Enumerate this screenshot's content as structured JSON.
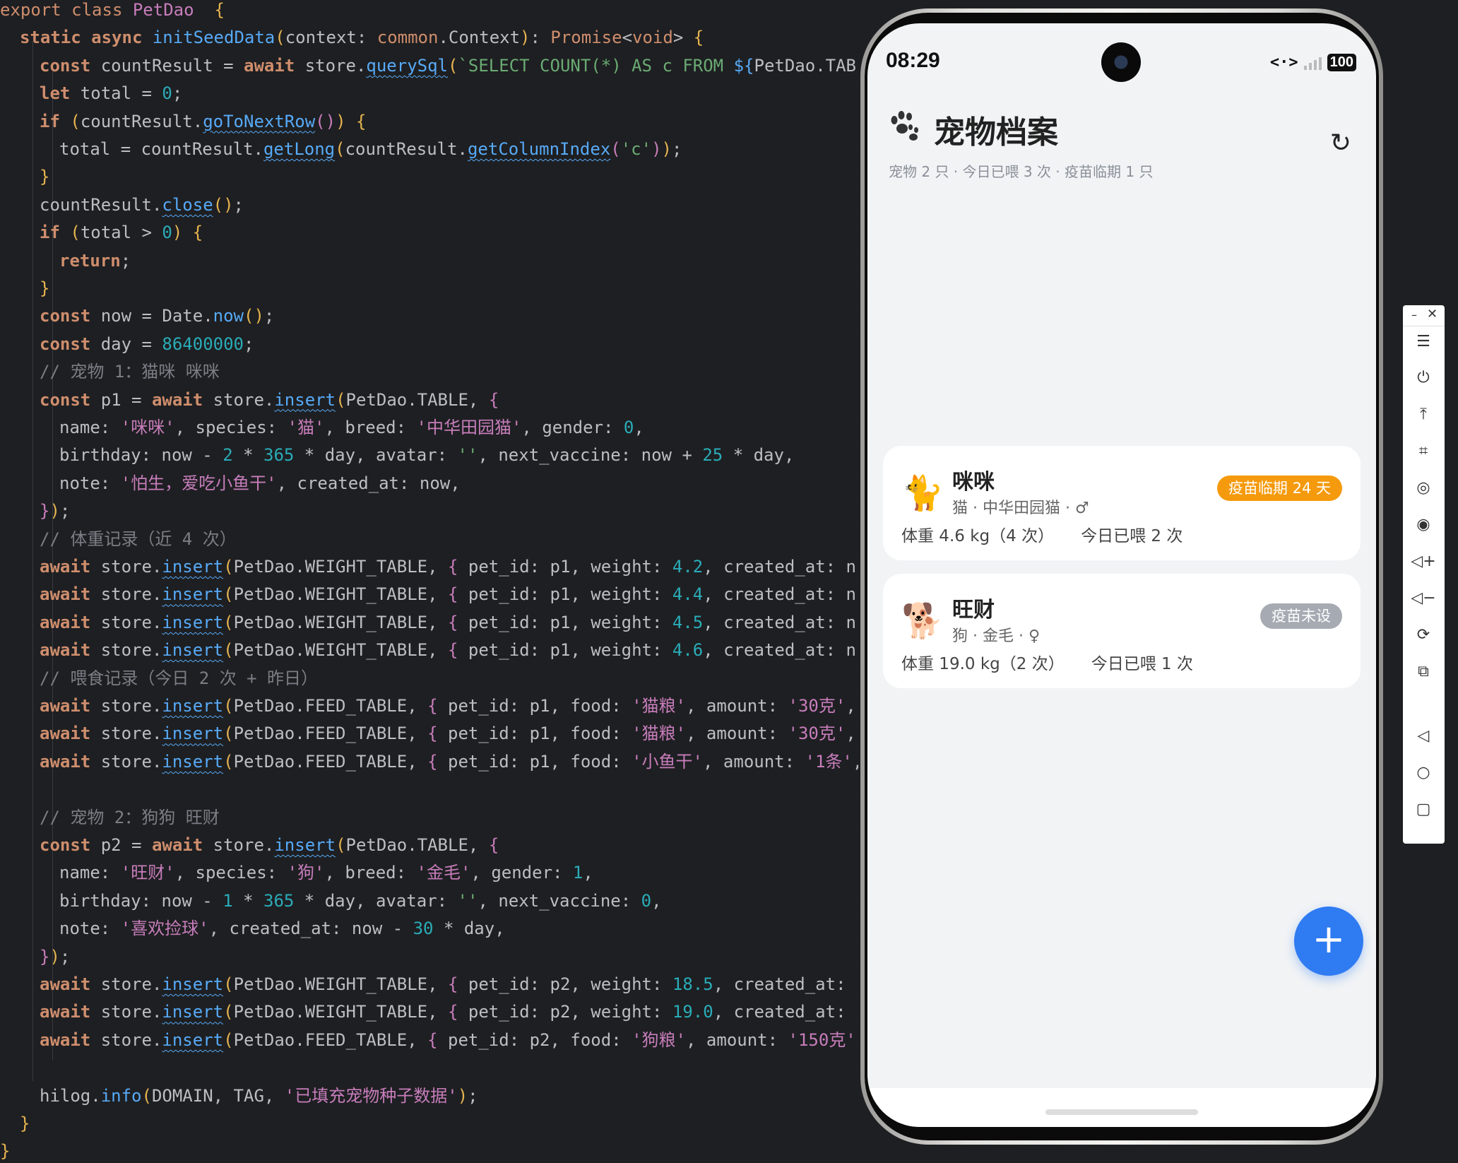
{
  "editor": {
    "lines": [
      {
        "i": 0,
        "tokens": [
          [
            "kw2",
            "export "
          ],
          [
            "kw2",
            "class "
          ],
          [
            "cls",
            "PetDao"
          ],
          [
            "",
            "  "
          ],
          [
            "p1",
            "{"
          ]
        ]
      },
      {
        "i": 1,
        "tokens": [
          [
            "kw",
            "static "
          ],
          [
            "kw",
            "async "
          ],
          [
            "fn",
            "initSeedData"
          ],
          [
            "p1",
            "("
          ],
          [
            "",
            "context: "
          ],
          [
            "ty",
            "common"
          ],
          [
            "",
            ".Context"
          ],
          [
            "p1",
            ")"
          ],
          [
            "",
            ": "
          ],
          [
            "ty",
            "Promise"
          ],
          [
            "",
            "<"
          ],
          [
            "ty",
            "void"
          ],
          [
            "",
            "> "
          ],
          [
            "p1",
            "{"
          ]
        ]
      },
      {
        "i": 2,
        "tokens": [
          [
            "kw",
            "const "
          ],
          [
            "",
            "countResult = "
          ],
          [
            "kw",
            "await "
          ],
          [
            "",
            "store."
          ],
          [
            "fnu",
            "querySql"
          ],
          [
            "p1",
            "("
          ],
          [
            "str",
            "`SELECT COUNT(*) AS c FROM "
          ],
          [
            "tmpl",
            "${"
          ],
          [
            "",
            "PetDao.TAB"
          ]
        ]
      },
      {
        "i": 2,
        "tokens": [
          [
            "kw",
            "let "
          ],
          [
            "",
            "total = "
          ],
          [
            "num",
            "0"
          ],
          [
            "",
            ";"
          ]
        ]
      },
      {
        "i": 2,
        "tokens": [
          [
            "kw",
            "if "
          ],
          [
            "p1",
            "("
          ],
          [
            "",
            "countResult."
          ],
          [
            "fnu",
            "goToNextRow"
          ],
          [
            "p2",
            "()"
          ],
          [
            "p1",
            ")"
          ],
          [
            "",
            " "
          ],
          [
            "p1",
            "{"
          ]
        ]
      },
      {
        "i": 3,
        "tokens": [
          [
            "",
            "total = countResult."
          ],
          [
            "fnu",
            "getLong"
          ],
          [
            "p1",
            "("
          ],
          [
            "",
            "countResult."
          ],
          [
            "fnu",
            "getColumnIndex"
          ],
          [
            "p2",
            "("
          ],
          [
            "str",
            "'c'"
          ],
          [
            "p2",
            ")"
          ],
          [
            "p1",
            ")"
          ],
          [
            "",
            ";"
          ]
        ]
      },
      {
        "i": 2,
        "tokens": [
          [
            "p1",
            "}"
          ]
        ]
      },
      {
        "i": 2,
        "tokens": [
          [
            "",
            "countResult."
          ],
          [
            "fnu",
            "close"
          ],
          [
            "p1",
            "()"
          ],
          [
            "",
            ";"
          ]
        ]
      },
      {
        "i": 2,
        "tokens": [
          [
            "kw",
            "if "
          ],
          [
            "p1",
            "("
          ],
          [
            "",
            "total > "
          ],
          [
            "num",
            "0"
          ],
          [
            "p1",
            ")"
          ],
          [
            "",
            " "
          ],
          [
            "p1",
            "{"
          ]
        ]
      },
      {
        "i": 3,
        "tokens": [
          [
            "kw",
            "return"
          ],
          [
            "",
            ";"
          ]
        ]
      },
      {
        "i": 2,
        "tokens": [
          [
            "p1",
            "}"
          ]
        ]
      },
      {
        "i": 2,
        "tokens": [
          [
            "kw",
            "const "
          ],
          [
            "",
            "now = Date."
          ],
          [
            "fn",
            "now"
          ],
          [
            "p1",
            "()"
          ],
          [
            "",
            ";"
          ]
        ]
      },
      {
        "i": 2,
        "tokens": [
          [
            "kw",
            "const "
          ],
          [
            "",
            "day = "
          ],
          [
            "num",
            "86400000"
          ],
          [
            "",
            ";"
          ]
        ]
      },
      {
        "i": 2,
        "tokens": [
          [
            "cm",
            "// 宠物 1：猫咪 咪咪"
          ]
        ]
      },
      {
        "i": 2,
        "tokens": [
          [
            "kw",
            "const "
          ],
          [
            "",
            "p1 = "
          ],
          [
            "kw",
            "await "
          ],
          [
            "",
            "store."
          ],
          [
            "fnu",
            "insert"
          ],
          [
            "p1",
            "("
          ],
          [
            "",
            "PetDao.TABLE, "
          ],
          [
            "p2",
            "{"
          ]
        ]
      },
      {
        "i": 3,
        "tokens": [
          [
            "",
            "name: "
          ],
          [
            "strp",
            "'咪咪'"
          ],
          [
            "",
            ", species: "
          ],
          [
            "strp",
            "'猫'"
          ],
          [
            "",
            ", breed: "
          ],
          [
            "strp",
            "'中华田园猫'"
          ],
          [
            "",
            ", gender: "
          ],
          [
            "num",
            "0"
          ],
          [
            "",
            ","
          ]
        ]
      },
      {
        "i": 3,
        "tokens": [
          [
            "",
            "birthday: now - "
          ],
          [
            "num",
            "2"
          ],
          [
            "",
            " * "
          ],
          [
            "num",
            "365"
          ],
          [
            "",
            " * day, avatar: "
          ],
          [
            "str",
            "''"
          ],
          [
            "",
            ", next_vaccine: now + "
          ],
          [
            "num",
            "25"
          ],
          [
            "",
            " * day,"
          ]
        ]
      },
      {
        "i": 3,
        "tokens": [
          [
            "",
            "note: "
          ],
          [
            "strp",
            "'怕生，爱吃小鱼干'"
          ],
          [
            "",
            ", created_at: now,"
          ]
        ]
      },
      {
        "i": 2,
        "tokens": [
          [
            "p2",
            "}"
          ],
          [
            "p1",
            ")"
          ],
          [
            "",
            ";"
          ]
        ]
      },
      {
        "i": 2,
        "tokens": [
          [
            "cm",
            "// 体重记录（近 4 次）"
          ]
        ]
      },
      {
        "i": 2,
        "tokens": [
          [
            "kw",
            "await "
          ],
          [
            "",
            "store."
          ],
          [
            "fnu",
            "insert"
          ],
          [
            "p1",
            "("
          ],
          [
            "",
            "PetDao.WEIGHT_TABLE, "
          ],
          [
            "p2",
            "{"
          ],
          [
            "",
            " pet_id: p1, weight: "
          ],
          [
            "num",
            "4.2"
          ],
          [
            "",
            ", created_at: n"
          ]
        ]
      },
      {
        "i": 2,
        "tokens": [
          [
            "kw",
            "await "
          ],
          [
            "",
            "store."
          ],
          [
            "fnu",
            "insert"
          ],
          [
            "p1",
            "("
          ],
          [
            "",
            "PetDao.WEIGHT_TABLE, "
          ],
          [
            "p2",
            "{"
          ],
          [
            "",
            " pet_id: p1, weight: "
          ],
          [
            "num",
            "4.4"
          ],
          [
            "",
            ", created_at: n"
          ]
        ]
      },
      {
        "i": 2,
        "tokens": [
          [
            "kw",
            "await "
          ],
          [
            "",
            "store."
          ],
          [
            "fnu",
            "insert"
          ],
          [
            "p1",
            "("
          ],
          [
            "",
            "PetDao.WEIGHT_TABLE, "
          ],
          [
            "p2",
            "{"
          ],
          [
            "",
            " pet_id: p1, weight: "
          ],
          [
            "num",
            "4.5"
          ],
          [
            "",
            ", created_at: n"
          ]
        ]
      },
      {
        "i": 2,
        "tokens": [
          [
            "kw",
            "await "
          ],
          [
            "",
            "store."
          ],
          [
            "fnu",
            "insert"
          ],
          [
            "p1",
            "("
          ],
          [
            "",
            "PetDao.WEIGHT_TABLE, "
          ],
          [
            "p2",
            "{"
          ],
          [
            "",
            " pet_id: p1, weight: "
          ],
          [
            "num",
            "4.6"
          ],
          [
            "",
            ", created_at: n"
          ]
        ]
      },
      {
        "i": 2,
        "tokens": [
          [
            "cm",
            "// 喂食记录（今日 2 次 + 昨日）"
          ]
        ]
      },
      {
        "i": 2,
        "tokens": [
          [
            "kw",
            "await "
          ],
          [
            "",
            "store."
          ],
          [
            "fnu",
            "insert"
          ],
          [
            "p1",
            "("
          ],
          [
            "",
            "PetDao.FEED_TABLE, "
          ],
          [
            "p2",
            "{"
          ],
          [
            "",
            " pet_id: p1, food: "
          ],
          [
            "strp",
            "'猫粮'"
          ],
          [
            "",
            ", amount: "
          ],
          [
            "strp",
            "'30克'"
          ],
          [
            "",
            ","
          ]
        ]
      },
      {
        "i": 2,
        "tokens": [
          [
            "kw",
            "await "
          ],
          [
            "",
            "store."
          ],
          [
            "fnu",
            "insert"
          ],
          [
            "p1",
            "("
          ],
          [
            "",
            "PetDao.FEED_TABLE, "
          ],
          [
            "p2",
            "{"
          ],
          [
            "",
            " pet_id: p1, food: "
          ],
          [
            "strp",
            "'猫粮'"
          ],
          [
            "",
            ", amount: "
          ],
          [
            "strp",
            "'30克'"
          ],
          [
            "",
            ","
          ]
        ]
      },
      {
        "i": 2,
        "tokens": [
          [
            "kw",
            "await "
          ],
          [
            "",
            "store."
          ],
          [
            "fnu",
            "insert"
          ],
          [
            "p1",
            "("
          ],
          [
            "",
            "PetDao.FEED_TABLE, "
          ],
          [
            "p2",
            "{"
          ],
          [
            "",
            " pet_id: p1, food: "
          ],
          [
            "strp",
            "'小鱼干'"
          ],
          [
            "",
            ", amount: "
          ],
          [
            "strp",
            "'1条'"
          ],
          [
            "",
            ","
          ]
        ]
      },
      {
        "i": 2,
        "tokens": []
      },
      {
        "i": 2,
        "tokens": [
          [
            "cm",
            "// 宠物 2：狗狗 旺财"
          ]
        ]
      },
      {
        "i": 2,
        "tokens": [
          [
            "kw",
            "const "
          ],
          [
            "",
            "p2 = "
          ],
          [
            "kw",
            "await "
          ],
          [
            "",
            "store."
          ],
          [
            "fnu",
            "insert"
          ],
          [
            "p1",
            "("
          ],
          [
            "",
            "PetDao.TABLE, "
          ],
          [
            "p2",
            "{"
          ]
        ]
      },
      {
        "i": 3,
        "tokens": [
          [
            "",
            "name: "
          ],
          [
            "strp",
            "'旺财'"
          ],
          [
            "",
            ", species: "
          ],
          [
            "strp",
            "'狗'"
          ],
          [
            "",
            ", breed: "
          ],
          [
            "strp",
            "'金毛'"
          ],
          [
            "",
            ", gender: "
          ],
          [
            "num",
            "1"
          ],
          [
            "",
            ","
          ]
        ]
      },
      {
        "i": 3,
        "tokens": [
          [
            "",
            "birthday: now - "
          ],
          [
            "num",
            "1"
          ],
          [
            "",
            " * "
          ],
          [
            "num",
            "365"
          ],
          [
            "",
            " * day, avatar: "
          ],
          [
            "str",
            "''"
          ],
          [
            "",
            ", next_vaccine: "
          ],
          [
            "num",
            "0"
          ],
          [
            "",
            ","
          ]
        ]
      },
      {
        "i": 3,
        "tokens": [
          [
            "",
            "note: "
          ],
          [
            "strp",
            "'喜欢捡球'"
          ],
          [
            "",
            ", created_at: now - "
          ],
          [
            "num",
            "30"
          ],
          [
            "",
            " * day,"
          ]
        ]
      },
      {
        "i": 2,
        "tokens": [
          [
            "p2",
            "}"
          ],
          [
            "p1",
            ")"
          ],
          [
            "",
            ";"
          ]
        ]
      },
      {
        "i": 2,
        "tokens": [
          [
            "kw",
            "await "
          ],
          [
            "",
            "store."
          ],
          [
            "fnu",
            "insert"
          ],
          [
            "p1",
            "("
          ],
          [
            "",
            "PetDao.WEIGHT_TABLE, "
          ],
          [
            "p2",
            "{"
          ],
          [
            "",
            " pet_id: p2, weight: "
          ],
          [
            "num",
            "18.5"
          ],
          [
            "",
            ", created_at:"
          ]
        ]
      },
      {
        "i": 2,
        "tokens": [
          [
            "kw",
            "await "
          ],
          [
            "",
            "store."
          ],
          [
            "fnu",
            "insert"
          ],
          [
            "p1",
            "("
          ],
          [
            "",
            "PetDao.WEIGHT_TABLE, "
          ],
          [
            "p2",
            "{"
          ],
          [
            "",
            " pet_id: p2, weight: "
          ],
          [
            "num",
            "19.0"
          ],
          [
            "",
            ", created_at:"
          ]
        ]
      },
      {
        "i": 2,
        "tokens": [
          [
            "kw",
            "await "
          ],
          [
            "",
            "store."
          ],
          [
            "fnu",
            "insert"
          ],
          [
            "p1",
            "("
          ],
          [
            "",
            "PetDao.FEED_TABLE, "
          ],
          [
            "p2",
            "{"
          ],
          [
            "",
            " pet_id: p2, food: "
          ],
          [
            "strp",
            "'狗粮'"
          ],
          [
            "",
            ", amount: "
          ],
          [
            "strp",
            "'150克'"
          ]
        ]
      },
      {
        "i": 2,
        "tokens": []
      },
      {
        "i": 2,
        "tokens": [
          [
            "",
            "hilog."
          ],
          [
            "fn",
            "info"
          ],
          [
            "p1",
            "("
          ],
          [
            "",
            "DOMAIN, TAG, "
          ],
          [
            "strp",
            "'已填充宠物种子数据'"
          ],
          [
            "p1",
            ")"
          ],
          [
            "",
            ";"
          ]
        ]
      },
      {
        "i": 1,
        "tokens": [
          [
            "p1",
            "}"
          ]
        ]
      },
      {
        "i": 0,
        "tokens": [
          [
            "p1",
            "}"
          ]
        ]
      }
    ]
  },
  "phone": {
    "status": {
      "time": "08:29",
      "net": "<·>",
      "battery": "100"
    },
    "header": {
      "title": "宠物档案",
      "subtitle": "宠物 2 只 · 今日已喂 3 次 · 疫苗临期 1 只"
    },
    "pets": [
      {
        "avatar": "🐈",
        "name": "咪咪",
        "meta": "猫 · 中华田园猫 · ♂",
        "weight": "体重 4.6 kg（4 次）",
        "fed": "今日已喂 2 次",
        "badge": "疫苗临期 24 天",
        "badge_color": "#f59a0c"
      },
      {
        "avatar": "🐕",
        "name": "旺财",
        "meta": "狗 · 金毛 · ♀",
        "weight": "体重 19.0 kg（2 次）",
        "fed": "今日已喂 1 次",
        "badge": "疫苗未设",
        "badge_color": "#a6abb3"
      }
    ],
    "fab": "+"
  },
  "toolbar": {
    "minimize": "–",
    "close": "✕",
    "buttons": [
      "menu-icon",
      "power-icon",
      "rotate-top-icon",
      "crop-icon",
      "screen-record-icon",
      "screenshot-icon",
      "volume-up-icon",
      "volume-down-icon",
      "rotate-icon",
      "multi-device-icon",
      "back-icon",
      "home-icon",
      "recents-icon"
    ]
  }
}
